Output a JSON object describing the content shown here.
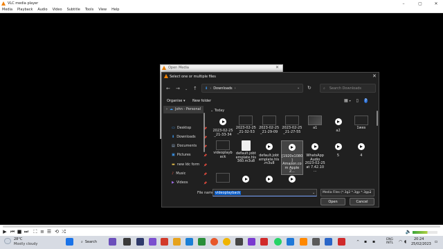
{
  "vlc": {
    "title": "VLC media player",
    "menu": [
      "Media",
      "Playback",
      "Audio",
      "Video",
      "Subtitle",
      "Tools",
      "View",
      "Help"
    ],
    "time_left": "",
    "time_right": ""
  },
  "open_media": {
    "title": "Open Media"
  },
  "dialog": {
    "title": "Select one or multiple files",
    "address": "Downloads",
    "search_placeholder": "Search Downloads",
    "organise": "Organise",
    "new_folder": "New folder",
    "group": "Today",
    "sidebar": [
      {
        "label": "John - Personal",
        "icon": "cloud-icon",
        "pinned": false
      },
      {
        "label": "Desktop",
        "icon": "desktop-icon",
        "pinned": true
      },
      {
        "label": "Downloads",
        "icon": "download-icon",
        "pinned": true
      },
      {
        "label": "Documents",
        "icon": "documents-icon",
        "pinned": true
      },
      {
        "label": "Pictures",
        "icon": "pictures-icon",
        "pinned": true
      },
      {
        "label": "new Idc form",
        "icon": "folder-icon",
        "pinned": true
      },
      {
        "label": "Music",
        "icon": "music-icon",
        "pinned": true
      },
      {
        "label": "Videos",
        "icon": "videos-icon",
        "pinned": true
      }
    ],
    "files": [
      {
        "name": "2023-02-25\n_21-33-34",
        "kind": "play"
      },
      {
        "name": "2023-02-25\n_21-32-53",
        "kind": "video"
      },
      {
        "name": "2023-02-25\n_21-29-09",
        "kind": "video"
      },
      {
        "name": "2023-02-25\n_21-27-55",
        "kind": "video"
      },
      {
        "name": "a1",
        "kind": "pic"
      },
      {
        "name": "a2",
        "kind": "play"
      },
      {
        "name": "1wes",
        "kind": "video"
      },
      {
        "name": "videoplayb\nack",
        "kind": "video"
      },
      {
        "name": "default.jobt\nemplate.hls\n360.m3u8",
        "kind": "doc"
      },
      {
        "name": "default.jobt\nemplate.hls\n.m3u8",
        "kind": "play"
      },
      {
        "name": "[1920x1080\n]\nAmazon.co\nm Apple 2...",
        "kind": "play"
      },
      {
        "name": "WhatsApp\nAudio\n2023-02-25\nat 7.42.10 ...",
        "kind": "play"
      },
      {
        "name": "5",
        "kind": "play"
      },
      {
        "name": "4",
        "kind": "play"
      },
      {
        "name": "",
        "kind": "video"
      },
      {
        "name": "",
        "kind": "play"
      },
      {
        "name": "",
        "kind": "play"
      },
      {
        "name": "",
        "kind": "play"
      }
    ],
    "file_name_label": "File name:",
    "file_name_value": "videoplayback",
    "filter": "Media Files (*.3g2 *.3gp *.3gp2",
    "open_label": "Open",
    "cancel_label": "Cancel"
  },
  "taskbar": {
    "temperature": "28°C",
    "weather": "Mostly cloudy",
    "search": "Search",
    "lang_line1": "ENG",
    "lang_line2": "INTL",
    "time": "20:24",
    "date": "25/02/2023"
  }
}
